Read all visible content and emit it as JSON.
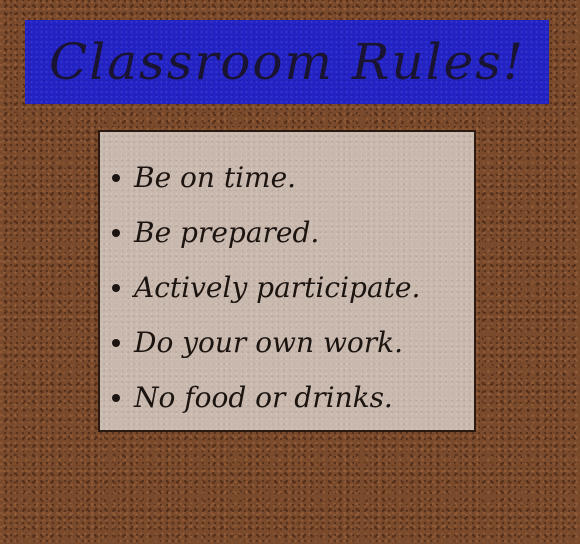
{
  "title": "Classroom Rules!",
  "colors": {
    "board_background": "#7a4a2c",
    "banner_background": "#2323c4",
    "card_background": "#c8b8ad",
    "text": "#1c1410"
  },
  "rules": [
    "Be on time.",
    "Be prepared.",
    "Actively participate.",
    "Do your own work.",
    "No food or drinks."
  ]
}
